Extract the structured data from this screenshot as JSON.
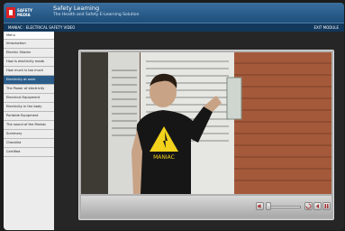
{
  "header": {
    "logo_line1": "SAFETY",
    "logo_line2": "MEDIA",
    "title": "Safety Learning",
    "subtitle": "The Health and Safety E-Learning Solution"
  },
  "navbar": {
    "breadcrumb": "MANIAC : ELECTRICAL SAFETY VIDEO",
    "exit_label": "EXIT MODULE"
  },
  "sidebar": {
    "header": "Menu",
    "items": [
      {
        "label": "Introduction"
      },
      {
        "label": "Electric Shocks"
      },
      {
        "label": "How is electricity made"
      },
      {
        "label": "How much is too much"
      },
      {
        "label": "Electricity at work"
      },
      {
        "label": "The Power of electricity"
      },
      {
        "label": "Electrical Equipment"
      },
      {
        "label": "Electricity in the body"
      },
      {
        "label": "Portable Equipment"
      },
      {
        "label": "The sound of the Maniac"
      },
      {
        "label": "Summary"
      },
      {
        "label": "Checklist"
      },
      {
        "label": "Certified"
      }
    ],
    "active_index": 4
  },
  "video": {
    "shirt_text": "MANIAC",
    "controls": {
      "volume_icon": "volume-icon",
      "rewind_icon": "rewind-icon",
      "pause_icon": "pause-icon",
      "previous_icon": "previous-icon",
      "next_icon": "next-icon"
    }
  },
  "colors": {
    "header_blue": "#1e4f7c",
    "active_item": "#2a5d8a",
    "icon_red": "#a33"
  }
}
